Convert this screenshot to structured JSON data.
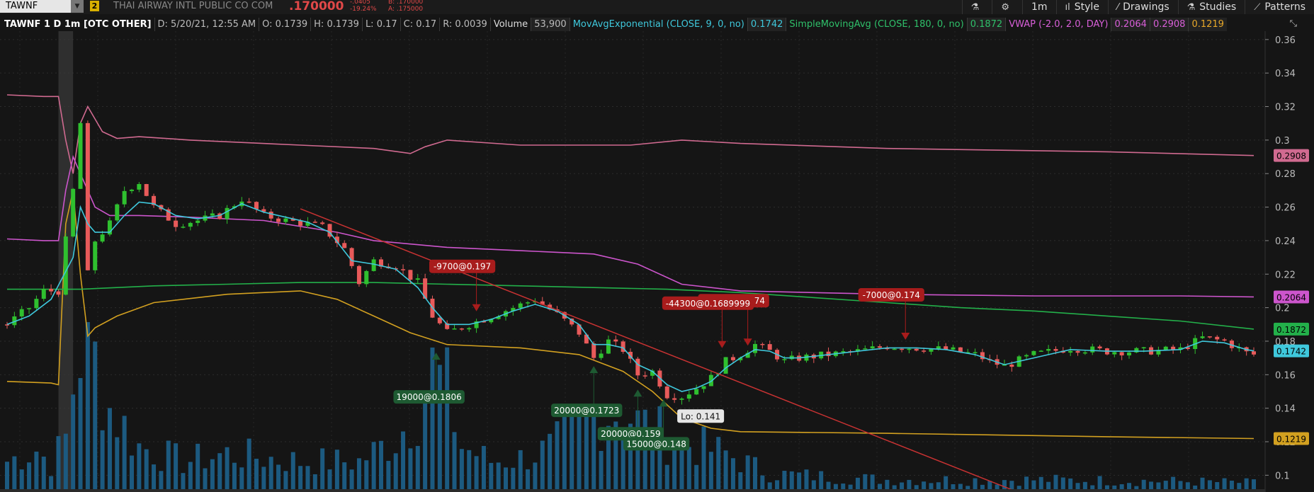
{
  "header": {
    "symbol": "TAWNF",
    "link_badge": "2",
    "company": "THAI AIRWAY INTL PUBLIC CO COM",
    "last": ".170000",
    "change": "-.0405",
    "change_pct": "-19.24%",
    "bid": "B: .170000",
    "ask": "A: .175000",
    "toolbar": {
      "flask_icon": "flask-icon",
      "gear_icon": "gear-icon",
      "timeframe": "1m",
      "style": "Style",
      "drawings": "Drawings",
      "studies": "Studies",
      "patterns": "Patterns"
    }
  },
  "infobar": {
    "title": "TAWNF 1 D 1m [OTC OTHER]",
    "date": "D: 5/20/21, 12:55 AM",
    "open": "O: 0.1739",
    "high": "H: 0.1739",
    "low": "L: 0.17",
    "close": "C: 0.17",
    "range": "R: 0.0039",
    "volume_label": "Volume",
    "volume_value": "53,900",
    "ema_label": "MovAvgExponential (CLOSE, 9, 0, no)",
    "ema_value": "0.1742",
    "sma_label": "SimpleMovingAvg (CLOSE, 180, 0, no)",
    "sma_value": "0.1872",
    "vwap_label": "VWAP (-2.0, 2.0, DAY)",
    "vwap_value": "0.2064",
    "vwap_upper": "0.2908",
    "vwap_lower": "0.1219"
  },
  "colors": {
    "background": "#151515",
    "up": "#2fc02f",
    "down": "#e85a5a",
    "ema": "#3fc8dc",
    "sma": "#23b04a",
    "vwap": "#cc55cc",
    "upper_band": "#d06a90",
    "lower_band": "#d2a020",
    "volume": "#1c5a80",
    "trendline": "#c83232",
    "sell_label": "#a81c1c",
    "buy_label": "#1e5a32"
  },
  "chart_data": {
    "type": "candlestick",
    "ylim": [
      0.09,
      0.365
    ],
    "y_ticks": [
      "0.1",
      "0.12",
      "0.14",
      "0.16",
      "0.18",
      "0.2",
      "0.22",
      "0.24",
      "0.26",
      "0.28",
      "0.3",
      "0.32",
      "0.34",
      "0.36"
    ],
    "price_labels": [
      {
        "text": "0.2908",
        "value": 0.2908,
        "color": "#d06a90"
      },
      {
        "text": "0.2064",
        "value": 0.2064,
        "color": "#cc55cc"
      },
      {
        "text": "0.1872",
        "value": 0.1872,
        "color": "#23b04a"
      },
      {
        "text": "0.1742",
        "value": 0.1742,
        "color": "#3fc8dc"
      },
      {
        "text": "0.1219",
        "value": 0.1219,
        "color": "#d2a020"
      }
    ],
    "close_path": [
      [
        0,
        0.19
      ],
      [
        3,
        0.2
      ],
      [
        5,
        0.21
      ],
      [
        7,
        0.21
      ],
      [
        9,
        0.27
      ],
      [
        10,
        0.31
      ],
      [
        11,
        0.22
      ],
      [
        12,
        0.24
      ],
      [
        14,
        0.25
      ],
      [
        16,
        0.27
      ],
      [
        18,
        0.275
      ],
      [
        20,
        0.26
      ],
      [
        23,
        0.25
      ],
      [
        26,
        0.252
      ],
      [
        29,
        0.255
      ],
      [
        32,
        0.265
      ],
      [
        35,
        0.255
      ],
      [
        38,
        0.252
      ],
      [
        41,
        0.25
      ],
      [
        43,
        0.248
      ],
      [
        46,
        0.235
      ],
      [
        48,
        0.215
      ],
      [
        50,
        0.228
      ],
      [
        53,
        0.225
      ],
      [
        56,
        0.215
      ],
      [
        58,
        0.195
      ],
      [
        60,
        0.185
      ],
      [
        63,
        0.19
      ],
      [
        66,
        0.195
      ],
      [
        69,
        0.2
      ],
      [
        72,
        0.205
      ],
      [
        75,
        0.196
      ],
      [
        78,
        0.185
      ],
      [
        80,
        0.17
      ],
      [
        82,
        0.18
      ],
      [
        84,
        0.175
      ],
      [
        86,
        0.16
      ],
      [
        88,
        0.162
      ],
      [
        90,
        0.148
      ],
      [
        92,
        0.147
      ],
      [
        94,
        0.152
      ],
      [
        96,
        0.158
      ],
      [
        98,
        0.168
      ],
      [
        100,
        0.172
      ],
      [
        102,
        0.178
      ],
      [
        104,
        0.174
      ],
      [
        106,
        0.168
      ],
      [
        108,
        0.17
      ],
      [
        112,
        0.172
      ],
      [
        116,
        0.174
      ],
      [
        120,
        0.177
      ],
      [
        124,
        0.176
      ],
      [
        128,
        0.175
      ],
      [
        132,
        0.172
      ],
      [
        134,
        0.168
      ],
      [
        136,
        0.165
      ],
      [
        140,
        0.172
      ],
      [
        145,
        0.176
      ],
      [
        150,
        0.174
      ],
      [
        155,
        0.174
      ],
      [
        160,
        0.175
      ],
      [
        163,
        0.182
      ],
      [
        166,
        0.18
      ],
      [
        169,
        0.173
      ],
      [
        170,
        0.172
      ]
    ],
    "ema_path": [
      [
        0,
        0.19
      ],
      [
        3,
        0.195
      ],
      [
        6,
        0.205
      ],
      [
        9,
        0.23
      ],
      [
        10,
        0.26
      ],
      [
        11,
        0.25
      ],
      [
        12,
        0.245
      ],
      [
        14,
        0.245
      ],
      [
        16,
        0.255
      ],
      [
        18,
        0.263
      ],
      [
        20,
        0.262
      ],
      [
        23,
        0.255
      ],
      [
        26,
        0.253
      ],
      [
        29,
        0.255
      ],
      [
        32,
        0.262
      ],
      [
        35,
        0.257
      ],
      [
        38,
        0.254
      ],
      [
        41,
        0.251
      ],
      [
        44,
        0.245
      ],
      [
        47,
        0.228
      ],
      [
        50,
        0.226
      ],
      [
        53,
        0.223
      ],
      [
        56,
        0.212
      ],
      [
        58,
        0.2
      ],
      [
        60,
        0.19
      ],
      [
        63,
        0.19
      ],
      [
        66,
        0.193
      ],
      [
        69,
        0.198
      ],
      [
        72,
        0.202
      ],
      [
        75,
        0.198
      ],
      [
        78,
        0.19
      ],
      [
        80,
        0.178
      ],
      [
        82,
        0.178
      ],
      [
        84,
        0.176
      ],
      [
        86,
        0.166
      ],
      [
        88,
        0.162
      ],
      [
        90,
        0.154
      ],
      [
        92,
        0.15
      ],
      [
        94,
        0.152
      ],
      [
        96,
        0.156
      ],
      [
        98,
        0.164
      ],
      [
        100,
        0.17
      ],
      [
        102,
        0.175
      ],
      [
        104,
        0.174
      ],
      [
        106,
        0.17
      ],
      [
        108,
        0.17
      ],
      [
        112,
        0.172
      ],
      [
        116,
        0.174
      ],
      [
        120,
        0.176
      ],
      [
        124,
        0.176
      ],
      [
        128,
        0.175
      ],
      [
        132,
        0.172
      ],
      [
        134,
        0.169
      ],
      [
        136,
        0.166
      ],
      [
        140,
        0.17
      ],
      [
        145,
        0.175
      ],
      [
        150,
        0.174
      ],
      [
        155,
        0.174
      ],
      [
        160,
        0.175
      ],
      [
        163,
        0.18
      ],
      [
        166,
        0.179
      ],
      [
        169,
        0.175
      ],
      [
        170,
        0.1742
      ]
    ],
    "sma_path": [
      [
        0,
        0.211
      ],
      [
        10,
        0.211
      ],
      [
        20,
        0.213
      ],
      [
        30,
        0.214
      ],
      [
        40,
        0.215
      ],
      [
        50,
        0.215
      ],
      [
        60,
        0.214
      ],
      [
        70,
        0.213
      ],
      [
        80,
        0.212
      ],
      [
        90,
        0.211
      ],
      [
        100,
        0.209
      ],
      [
        110,
        0.206
      ],
      [
        120,
        0.203
      ],
      [
        130,
        0.2
      ],
      [
        140,
        0.198
      ],
      [
        150,
        0.195
      ],
      [
        160,
        0.192
      ],
      [
        170,
        0.1872
      ]
    ],
    "vwap_path": [
      [
        0,
        0.241
      ],
      [
        5,
        0.24
      ],
      [
        7,
        0.24
      ],
      [
        8,
        0.27
      ],
      [
        9,
        0.29
      ],
      [
        10,
        0.28
      ],
      [
        12,
        0.26
      ],
      [
        14,
        0.255
      ],
      [
        18,
        0.255
      ],
      [
        25,
        0.254
      ],
      [
        35,
        0.252
      ],
      [
        45,
        0.245
      ],
      [
        50,
        0.24
      ],
      [
        60,
        0.236
      ],
      [
        70,
        0.234
      ],
      [
        80,
        0.232
      ],
      [
        86,
        0.226
      ],
      [
        92,
        0.214
      ],
      [
        100,
        0.21
      ],
      [
        110,
        0.209
      ],
      [
        120,
        0.208
      ],
      [
        140,
        0.207
      ],
      [
        160,
        0.207
      ],
      [
        170,
        0.2064
      ]
    ],
    "upper_band_path": [
      [
        0,
        0.327
      ],
      [
        5,
        0.326
      ],
      [
        7,
        0.326
      ],
      [
        8,
        0.3
      ],
      [
        9,
        0.28
      ],
      [
        10,
        0.31
      ],
      [
        11,
        0.32
      ],
      [
        13,
        0.305
      ],
      [
        15,
        0.301
      ],
      [
        18,
        0.302
      ],
      [
        25,
        0.3
      ],
      [
        40,
        0.297
      ],
      [
        50,
        0.295
      ],
      [
        55,
        0.292
      ],
      [
        57,
        0.296
      ],
      [
        60,
        0.3
      ],
      [
        70,
        0.297
      ],
      [
        85,
        0.297
      ],
      [
        92,
        0.3
      ],
      [
        100,
        0.298
      ],
      [
        120,
        0.295
      ],
      [
        150,
        0.293
      ],
      [
        170,
        0.2908
      ]
    ],
    "lower_band_path": [
      [
        0,
        0.156
      ],
      [
        6,
        0.155
      ],
      [
        7,
        0.154
      ],
      [
        8,
        0.25
      ],
      [
        9,
        0.27
      ],
      [
        10,
        0.22
      ],
      [
        11,
        0.183
      ],
      [
        12,
        0.188
      ],
      [
        15,
        0.195
      ],
      [
        20,
        0.203
      ],
      [
        30,
        0.208
      ],
      [
        40,
        0.21
      ],
      [
        45,
        0.205
      ],
      [
        50,
        0.195
      ],
      [
        55,
        0.185
      ],
      [
        60,
        0.178
      ],
      [
        70,
        0.176
      ],
      [
        78,
        0.172
      ],
      [
        84,
        0.162
      ],
      [
        88,
        0.15
      ],
      [
        92,
        0.134
      ],
      [
        96,
        0.128
      ],
      [
        100,
        0.126
      ],
      [
        120,
        0.125
      ],
      [
        150,
        0.123
      ],
      [
        170,
        0.1219
      ]
    ],
    "volume_path": [
      [
        0,
        0.2
      ],
      [
        4,
        0.28
      ],
      [
        6,
        0.18
      ],
      [
        8,
        0.35
      ],
      [
        9,
        0.7
      ],
      [
        10,
        0.95
      ],
      [
        11,
        1.0
      ],
      [
        12,
        0.85
      ],
      [
        14,
        0.55
      ],
      [
        18,
        0.3
      ],
      [
        24,
        0.2
      ],
      [
        30,
        0.25
      ],
      [
        40,
        0.2
      ],
      [
        48,
        0.2
      ],
      [
        53,
        0.35
      ],
      [
        56,
        0.55
      ],
      [
        58,
        0.8
      ],
      [
        60,
        0.65
      ],
      [
        62,
        0.3
      ],
      [
        66,
        0.2
      ],
      [
        70,
        0.22
      ],
      [
        74,
        0.28
      ],
      [
        76,
        0.35
      ],
      [
        78,
        0.45
      ],
      [
        80,
        0.5
      ],
      [
        84,
        0.55
      ],
      [
        86,
        0.45
      ],
      [
        88,
        0.42
      ],
      [
        90,
        0.35
      ],
      [
        94,
        0.3
      ],
      [
        98,
        0.25
      ],
      [
        104,
        0.12
      ],
      [
        120,
        0.08
      ],
      [
        140,
        0.08
      ],
      [
        160,
        0.07
      ],
      [
        170,
        0.06
      ]
    ],
    "trendline": {
      "from": [
        40,
        0.259
      ],
      "to": [
        143,
        0.081
      ]
    },
    "lo_marker": {
      "x": 91,
      "value": 0.141,
      "text": "Lo: 0.141"
    },
    "trade_labels": [
      {
        "text": "-9700@0.197",
        "side": "sell",
        "x": 64,
        "price": 0.197
      },
      {
        "text": "-13000@0.174",
        "side": "sell",
        "x": 101,
        "price": 0.1765
      },
      {
        "text": "-44300@0.1689999",
        "side": "sell",
        "x": 97.5,
        "price": 0.175
      },
      {
        "text": "-7000@0.174",
        "side": "sell",
        "x": 122.5,
        "price": 0.18
      },
      {
        "text": "19000@0.1806",
        "side": "buy",
        "x": 58.5,
        "price": 0.174
      },
      {
        "text": "20000@0.1723",
        "side": "buy",
        "x": 80,
        "price": 0.166
      },
      {
        "text": "20000@0.159",
        "side": "buy",
        "x": 86,
        "price": 0.152
      },
      {
        "text": "15000@0.148",
        "side": "buy",
        "x": 89.5,
        "price": 0.146
      }
    ]
  }
}
